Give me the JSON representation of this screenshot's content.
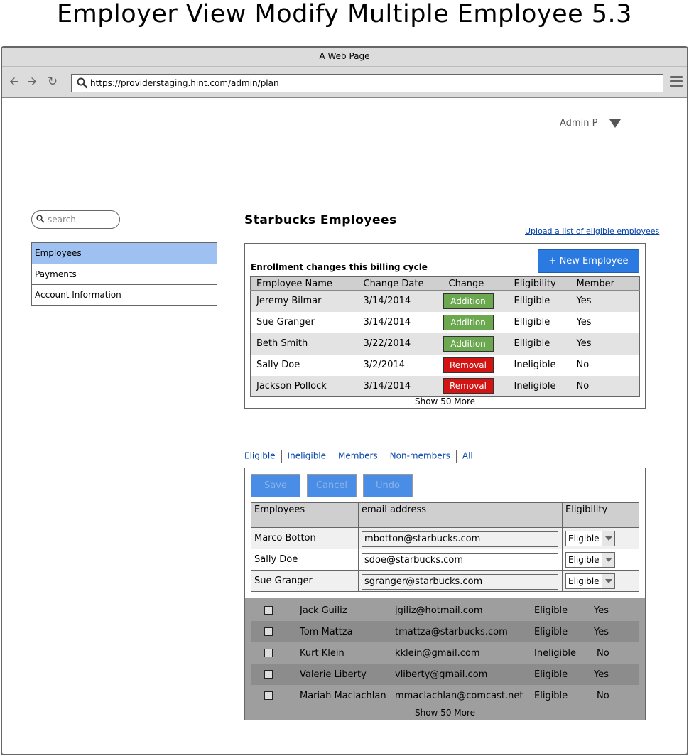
{
  "page_title": "Employer View Modify Multiple Employee 5.3",
  "browser": {
    "window_title": "A Web Page",
    "url": "https://providerstaging.hint.com/admin/plan"
  },
  "header": {
    "user": "Admin P"
  },
  "sidebar": {
    "search_placeholder": "search",
    "items": [
      {
        "label": "Employees",
        "active": true
      },
      {
        "label": "Payments"
      },
      {
        "label": "Account Information"
      }
    ]
  },
  "main": {
    "title": "Starbucks Employees",
    "upload_link": "Upload a list of eligible employees",
    "enrollment": {
      "heading": "Enrollment changes this billing cycle",
      "new_button": "+ New Employee",
      "columns": [
        "Employee Name",
        "Change Date",
        "Change",
        "Eligibility",
        "Member"
      ],
      "rows": [
        {
          "name": "Jeremy Bilmar",
          "date": "3/14/2014",
          "change": "Addition",
          "eligibility": "Elligible",
          "member": "Yes"
        },
        {
          "name": "Sue Granger",
          "date": "3/14/2014",
          "change": "Addition",
          "eligibility": "Elligible",
          "member": "Yes"
        },
        {
          "name": "Beth Smith",
          "date": "3/22/2014",
          "change": "Addition",
          "eligibility": "Elligible",
          "member": "Yes"
        },
        {
          "name": "Sally Doe",
          "date": "3/2/2014",
          "change": "Removal",
          "eligibility": "Ineligible",
          "member": "No"
        },
        {
          "name": "Jackson Pollock",
          "date": "3/14/2014",
          "change": "Removal",
          "eligibility": "Ineligible",
          "member": "No"
        }
      ],
      "show_more": "Show 50 More"
    },
    "filters": [
      "Eligible",
      "Ineligible",
      "Members",
      "Non-members",
      "All"
    ],
    "editor": {
      "buttons": {
        "save": "Save",
        "cancel": "Cancel",
        "undo": "Undo"
      },
      "columns": [
        "Employees",
        "email address",
        "Eligibility"
      ],
      "rows": [
        {
          "name": "Marco Botton",
          "email": "mbotton@starbucks.com",
          "eligibility": "Eligible"
        },
        {
          "name": "Sally Doe",
          "email": "sdoe@starbucks.com",
          "eligibility": "Eligible"
        },
        {
          "name": "Sue Granger",
          "email": "sgranger@starbucks.com",
          "eligibility": "Eligible"
        }
      ],
      "list": [
        {
          "name": "Jack Guiliz",
          "email": "jgiliz@hotmail.com",
          "eligibility": "Eligible",
          "member": "Yes"
        },
        {
          "name": "Tom Mattza",
          "email": "tmattza@starbucks.com",
          "eligibility": "Eligible",
          "member": "Yes"
        },
        {
          "name": "Kurt Klein",
          "email": "kklein@gmail.com",
          "eligibility": "Ineligible",
          "member": "No"
        },
        {
          "name": "Valerie Liberty",
          "email": "vliberty@gmail.com",
          "eligibility": "Eligible",
          "member": "Yes"
        },
        {
          "name": "Mariah Maclachlan",
          "email": "mmaclachlan@comcast.net",
          "eligibility": "Eligible",
          "member": "No"
        }
      ],
      "show_more": "Show 50 More"
    }
  }
}
